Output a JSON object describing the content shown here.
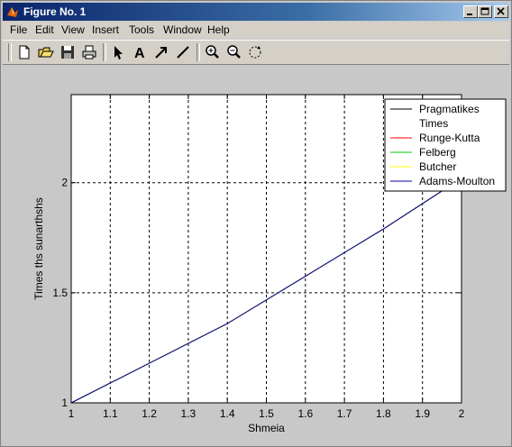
{
  "window": {
    "title": "Figure No. 1",
    "title_bar_color": "#0a246a"
  },
  "menu": {
    "items": [
      "File",
      "Edit",
      "View",
      "Insert",
      "Tools",
      "Window",
      "Help"
    ]
  },
  "toolbar": {
    "buttons": [
      "new-figure-icon",
      "open-file-icon",
      "save-icon",
      "print-icon",
      "edit-plot-arrow-icon",
      "insert-text-icon",
      "insert-arrow-icon",
      "insert-line-icon",
      "zoom-in-icon",
      "zoom-out-icon",
      "rotate-3d-icon"
    ]
  },
  "chart_data": {
    "type": "line",
    "xlabel": "Shmeia",
    "ylabel": "Times ths sunarthshs",
    "title": "",
    "xlim": [
      1,
      2
    ],
    "ylim": [
      1,
      2.4
    ],
    "x_ticks": [
      "1",
      "1.1",
      "1.2",
      "1.3",
      "1.4",
      "1.5",
      "1.6",
      "1.7",
      "1.8",
      "1.9",
      "2"
    ],
    "y_ticks": [
      "1",
      "1.5",
      "2"
    ],
    "grid": true,
    "legend_position": "top-right",
    "legend": [
      "Pragmatikes Times",
      "Runge-Kutta",
      "Felberg",
      "Butcher",
      "Adams-Moulton"
    ],
    "legend_lines": [
      "Pragmatikes",
      "Times",
      "Runge-Kutta",
      "Felberg",
      "Butcher",
      "Adams-Moulton"
    ],
    "series": [
      {
        "name": "Pragmatikes Times",
        "color": "#000000",
        "x": [
          1,
          1.2,
          1.4,
          1.6,
          1.8,
          2
        ],
        "y": [
          1,
          1.18,
          1.36,
          1.575,
          1.79,
          2.02
        ]
      },
      {
        "name": "Runge-Kutta",
        "color": "#ff0000",
        "x": [
          1,
          1.2,
          1.4,
          1.6,
          1.8,
          2
        ],
        "y": [
          1,
          1.18,
          1.36,
          1.575,
          1.79,
          2.02
        ]
      },
      {
        "name": "Felberg",
        "color": "#00cc00",
        "x": [
          1,
          1.2,
          1.4,
          1.6,
          1.8,
          2
        ],
        "y": [
          1,
          1.18,
          1.36,
          1.575,
          1.79,
          2.02
        ]
      },
      {
        "name": "Butcher",
        "color": "#ffff00",
        "x": [
          1,
          1.2,
          1.4,
          1.6,
          1.8,
          2
        ],
        "y": [
          1,
          1.18,
          1.36,
          1.575,
          1.79,
          2.02
        ]
      },
      {
        "name": "Adams-Moulton",
        "color": "#0000aa",
        "x": [
          1,
          1.2,
          1.4,
          1.6,
          1.8,
          2
        ],
        "y": [
          1,
          1.18,
          1.36,
          1.575,
          1.79,
          2.02
        ]
      }
    ]
  }
}
